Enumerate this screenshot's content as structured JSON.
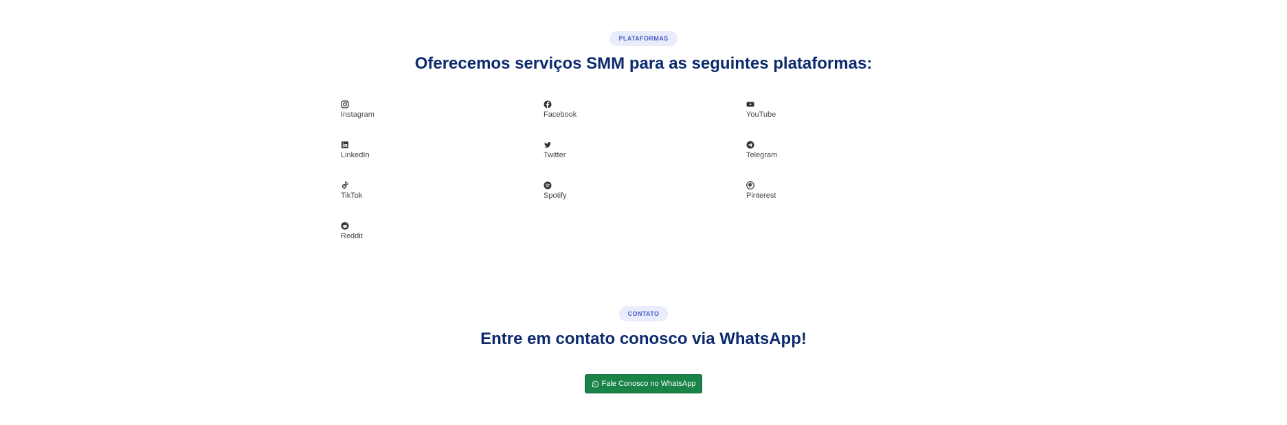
{
  "platforms_section": {
    "badge": "PLATAFORMAS",
    "heading": "Oferecemos serviços SMM para as seguintes plataformas:",
    "items": [
      {
        "label": "Instagram",
        "icon": "instagram-icon"
      },
      {
        "label": "Facebook",
        "icon": "facebook-icon"
      },
      {
        "label": "YouTube",
        "icon": "youtube-icon"
      },
      {
        "label": "LinkedIn",
        "icon": "linkedin-icon"
      },
      {
        "label": "Twitter",
        "icon": "twitter-icon"
      },
      {
        "label": "Telegram",
        "icon": "telegram-icon"
      },
      {
        "label": "TikTok",
        "icon": "tiktok-icon"
      },
      {
        "label": "Spotify",
        "icon": "spotify-icon"
      },
      {
        "label": "Pinterest",
        "icon": "pinterest-icon"
      },
      {
        "label": "Reddit",
        "icon": "reddit-icon"
      }
    ]
  },
  "contact_section": {
    "badge": "CONTATO",
    "heading": "Entre em contato conosco via WhatsApp!",
    "button_label": "Fale Conosco no WhatsApp",
    "button_icon": "whatsapp-icon"
  },
  "colors": {
    "heading": "#0c2a6e",
    "badge_bg": "#e8ecfb",
    "badge_text": "#4d5fc7",
    "whatsapp_button": "#1a8348"
  }
}
